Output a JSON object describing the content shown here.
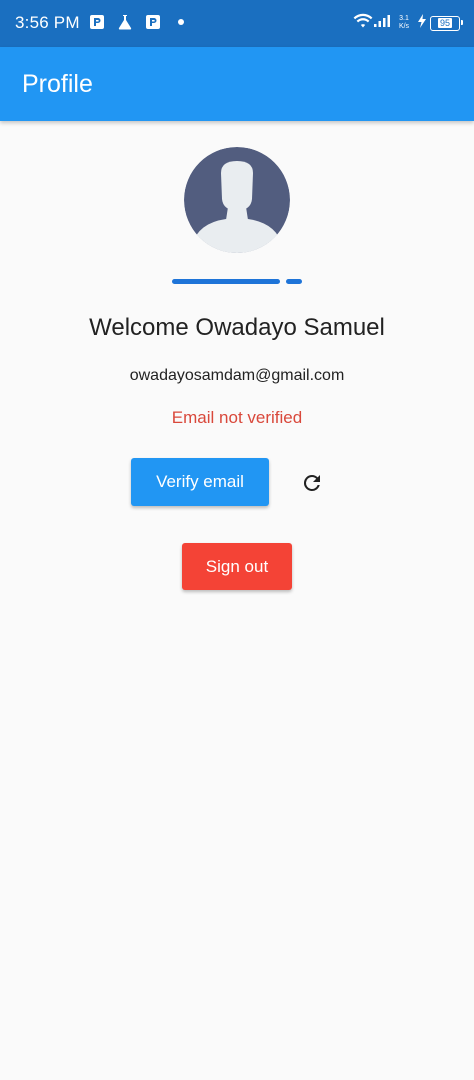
{
  "status_bar": {
    "time": "3:56 PM",
    "notification_icons": [
      "parking-icon",
      "flask-icon",
      "parking-icon",
      "dot-icon"
    ],
    "net_speed_value": "3.1",
    "net_speed_unit": "K/s",
    "battery": "95"
  },
  "app_bar": {
    "title": "Profile",
    "color": "#2196f3"
  },
  "profile": {
    "avatar_icon": "person-silhouette-icon",
    "welcome_text": "Welcome Owadayo Samuel",
    "email": "owadayosamdam@gmail.com",
    "verification_status": "Email not verified",
    "status_color": "#d9483b",
    "loading_progress": 0.88
  },
  "actions": {
    "verify_label": "Verify email",
    "verify_color": "#2196f3",
    "refresh_icon": "refresh-icon",
    "signout_label": "Sign out",
    "signout_color": "#f44336"
  }
}
